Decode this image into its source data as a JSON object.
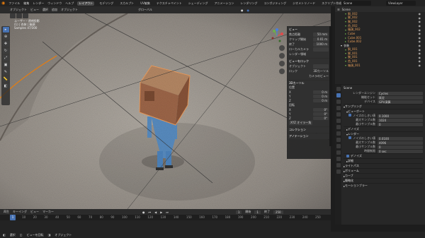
{
  "topbar": {
    "menus": [
      "ファイル",
      "編集",
      "レンダー",
      "ウィンドウ",
      "ヘルプ"
    ],
    "workspaces": [
      "レイアウト",
      "モデリング",
      "スカルプト",
      "UV編集",
      "テクスチャペイント",
      "シェーディング",
      "アニメーション",
      "レンダリング",
      "コンポジティング",
      "ジオメトリノード",
      "スクリプト作成"
    ],
    "active_workspace": "レイアウト",
    "scene_name": "Scene",
    "view_layer": "ViewLayer"
  },
  "viewport_header": {
    "mode": "オブジェクト",
    "menus": [
      "ビュー",
      "選択",
      "追加",
      "オブジェクト"
    ],
    "transform": "グローバル",
    "options_label": "オプション"
  },
  "viewport_overlay": {
    "line1": "ユーザー・透視投影",
    "line2": "(1) | 衣装 | 箱頭",
    "line3": "Samples 47/300"
  },
  "npanel": {
    "view_title": "ビュー",
    "focal_label": "焦点距離",
    "focal_value": "50 mm",
    "clip_start_label": "クリップ開始",
    "clip_start_value": "0.01 m",
    "clip_end_label": "終了",
    "clip_end_value": "1000 m",
    "local_camera_label": "ローカルカメラ",
    "render_region_label": "レンダー領域",
    "view_lock_title": "ビューをロック",
    "lock_object_label": "オブジェクト",
    "lock_to_label": "ロック",
    "lock_to_cursor": "3Dカーソル",
    "lock_camera": "カメラのビュー",
    "cursor_title": "3Dカーソル",
    "loc_label": "位置",
    "loc_x": "0 m",
    "loc_y": "0 m",
    "loc_z": "0 m",
    "rot_label": "回転",
    "rot_x": "0°",
    "rot_y": "0°",
    "rot_z": "0°",
    "rot_mode": "XYZ オイラー角",
    "collection_title": "コレクション",
    "annotation_title": "アノテーション"
  },
  "outliner": {
    "header": "Scene",
    "search": "View Layer",
    "rows": [
      {
        "label": "胴_002"
      },
      {
        "label": "脚_002"
      },
      {
        "label": "腕_002"
      },
      {
        "label": "首_002"
      },
      {
        "label": "箱頭_002"
      },
      {
        "label": "Cube"
      },
      {
        "label": "Cube.001"
      },
      {
        "label": "Cube.002"
      },
      {
        "label": "衣装"
      },
      {
        "label": "胴_001"
      },
      {
        "label": "脚_001"
      },
      {
        "label": "腕_001"
      },
      {
        "label": "首_001"
      },
      {
        "label": "箱頭_001"
      }
    ]
  },
  "properties": {
    "scene_label": "Scene",
    "engine_label": "レンダーエンジン",
    "engine_value": "Cycles",
    "feature_label": "機能セット",
    "feature_value": "既定",
    "device_label": "デバイス",
    "device_value": "GPU演算",
    "sampling_title": "サンプリング",
    "viewport_sub": "ビューポート",
    "noise_threshold_label": "ノイズのしきい値",
    "noise_threshold_value": "0.1000",
    "max_samples_label": "最大サンプル数",
    "max_samples_value": "1024",
    "min_samples_label": "最小サンプル数",
    "min_samples_value": "0",
    "denoise_title": "デノイズ",
    "render_sub": "レンダー",
    "r_noise_value": "0.0100",
    "r_max_value": "4096",
    "r_min_value": "0",
    "time_limit_label": "時間制限",
    "time_limit_value": "0 sec",
    "denoise2_title": "デノイズ",
    "advanced_title": "詳細",
    "light_paths_title": "ライトパス",
    "volumes_title": "ボリューム",
    "curves_title": "カーブ",
    "simplify_title": "簡略化",
    "motion_blur_title": "モーションブラー"
  },
  "timeline": {
    "menus": [
      "再生",
      "キーイング",
      "ビュー",
      "マーカー"
    ],
    "current_frame": "1",
    "start_label": "開始",
    "start_value": "1",
    "end_label": "終了",
    "end_value": "250",
    "ticks": [
      "0",
      "10",
      "20",
      "30",
      "40",
      "50",
      "60",
      "70",
      "80",
      "90",
      "100",
      "110",
      "120",
      "130",
      "140",
      "150",
      "160",
      "170",
      "180",
      "190",
      "200",
      "210",
      "220",
      "230",
      "240",
      "250"
    ]
  },
  "statusbar": {
    "select": "選択",
    "rotate": "ビューを回転",
    "menu": "オブジェクト"
  },
  "colors": {
    "accent": "#4772b3",
    "object_orange": "#e09a58",
    "box_brown": "#a0684a",
    "figure_blue": "#5a8fc4"
  }
}
